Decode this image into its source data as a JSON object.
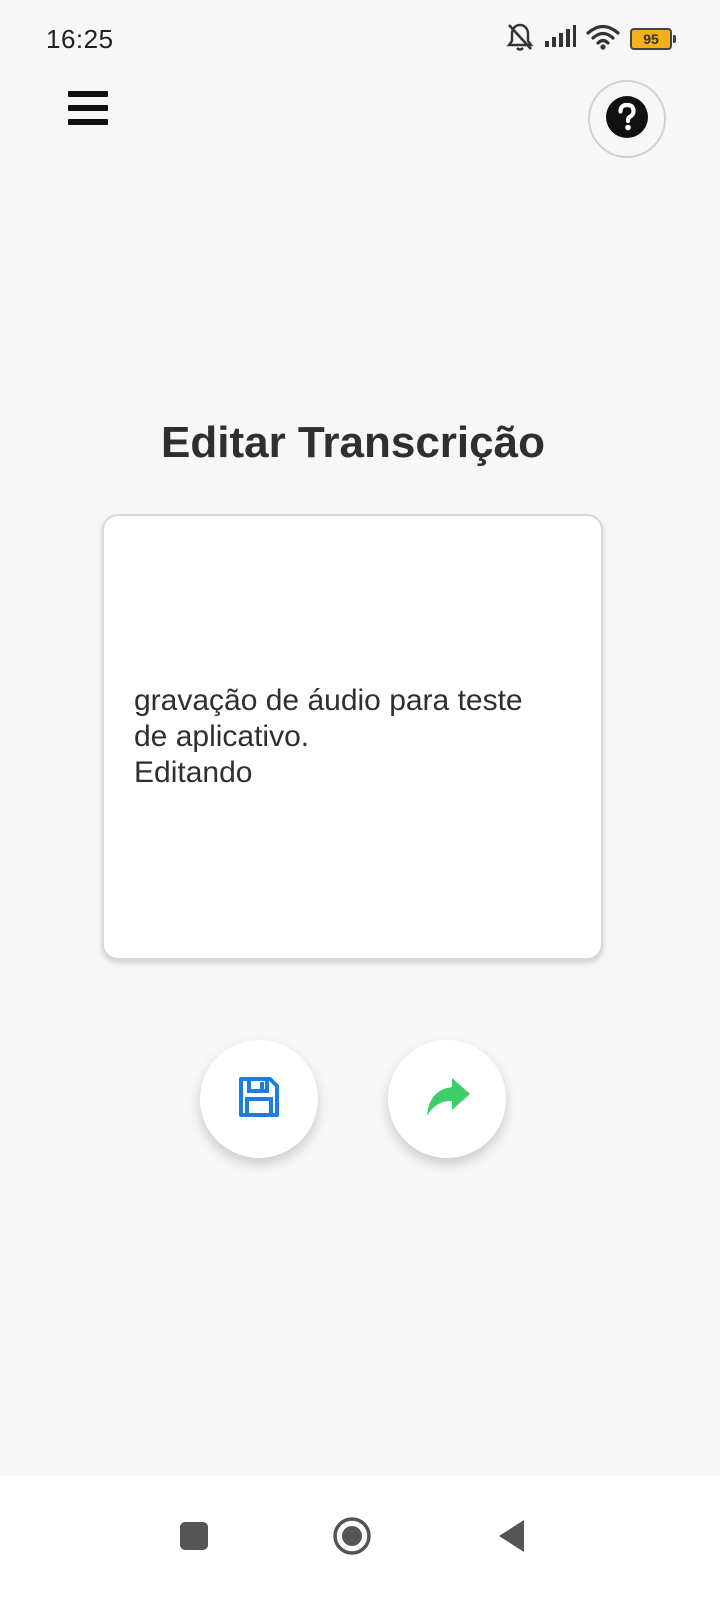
{
  "status_bar": {
    "time": "16:25",
    "battery_level": "95",
    "icons": [
      "bell-off-icon",
      "signal-icon",
      "wifi-icon",
      "battery-icon"
    ]
  },
  "header": {
    "menu_icon": "hamburger-menu-icon",
    "help_icon": "question-circle-icon"
  },
  "main": {
    "title": "Editar Transcrição",
    "transcription_text": "gravação de áudio para teste\nde aplicativo.\nEditando",
    "actions": [
      {
        "name": "save",
        "icon": "floppy-disk-icon",
        "color": "#1a7fe0"
      },
      {
        "name": "share",
        "icon": "share-arrow-icon",
        "color": "#3dce6a"
      }
    ]
  },
  "nav_bar": {
    "buttons": [
      "recent-apps-icon",
      "home-icon",
      "back-icon"
    ]
  },
  "colors": {
    "background": "#f7f7f7",
    "save_blue": "#1a7fe0",
    "share_green": "#3dce6a",
    "battery": "#f2b01e"
  }
}
